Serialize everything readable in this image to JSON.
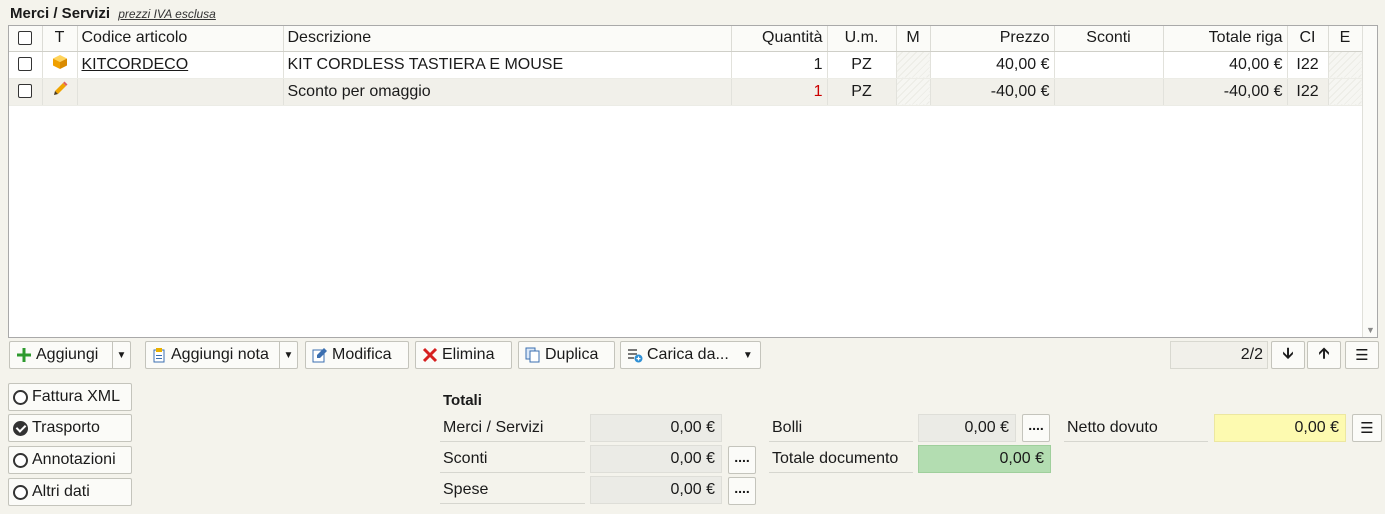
{
  "section": {
    "title": "Merci / Servizi",
    "note": "prezzi IVA esclusa"
  },
  "columns": [
    "T",
    "Codice articolo",
    "Descrizione",
    "Quantità",
    "U.m.",
    "M",
    "Prezzo",
    "Sconti",
    "Totale riga",
    "CI",
    "E"
  ],
  "rows": [
    {
      "code": "KITCORDECO",
      "desc": "KIT CORDLESS TASTIERA E MOUSE",
      "qty": "1",
      "um": "PZ",
      "price": "40,00 €",
      "sconti": "",
      "total": "40,00 €",
      "ci": "I22"
    },
    {
      "code": "",
      "desc": "Sconto per omaggio",
      "qty": "1",
      "um": "PZ",
      "price": "-40,00 €",
      "sconti": "",
      "total": "-40,00 €",
      "ci": "I22"
    }
  ],
  "toolbar": {
    "add": "Aggiungi",
    "add_note": "Aggiungi nota",
    "edit": "Modifica",
    "delete": "Elimina",
    "duplicate": "Duplica",
    "load_from": "Carica da...",
    "pager": "2/2"
  },
  "options": [
    {
      "label": "Fattura XML",
      "checked": false
    },
    {
      "label": "Trasporto",
      "checked": true
    },
    {
      "label": "Annotazioni",
      "checked": false
    },
    {
      "label": "Altri dati",
      "checked": false
    }
  ],
  "totals": {
    "title": "Totali",
    "merci_label": "Merci / Servizi",
    "merci_value": "0,00 €",
    "sconti_label": "Sconti",
    "sconti_value": "0,00 €",
    "spese_label": "Spese",
    "spese_value": "0,00 €",
    "bolli_label": "Bolli",
    "bolli_value": "0,00 €",
    "totale_label": "Totale documento",
    "totale_value": "0,00 €",
    "netto_label": "Netto dovuto",
    "netto_value": "0,00 €",
    "dots": "...."
  },
  "colors": {
    "netto_bg": "#fdfab0",
    "totale_bg": "#b3ddb1",
    "add_green": "#2e9a2e",
    "delete_red": "#d62020",
    "pencil": "#f0a400"
  }
}
